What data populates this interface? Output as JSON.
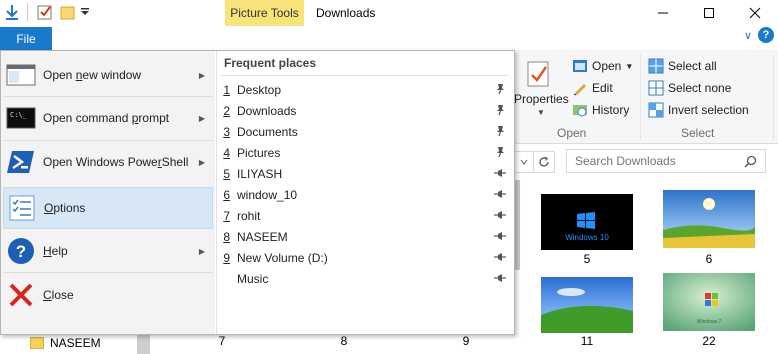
{
  "titlebar": {
    "contextual_tab": "Picture Tools",
    "title": "Downloads"
  },
  "tabs": {
    "file": "File"
  },
  "ribbon": {
    "properties_label": "Properties",
    "open_label": "Open",
    "edit_label": "Edit",
    "history_label": "History",
    "open_group": "Open",
    "select_all": "Select all",
    "select_none": "Select none",
    "invert_selection": "Invert selection",
    "select_group": "Select"
  },
  "search": {
    "placeholder": "Search Downloads"
  },
  "file_menu": {
    "items": [
      {
        "pre": "Open ",
        "key": "n",
        "post": "ew window",
        "icon": "new-window-icon"
      },
      {
        "pre": "Open command ",
        "key": "p",
        "post": "rompt",
        "icon": "command-prompt-icon"
      },
      {
        "pre": "Open Windows Powe",
        "key": "r",
        "post": "Shell",
        "icon": "powershell-icon"
      },
      {
        "pre": "",
        "key": "O",
        "post": "ptions",
        "icon": "options-icon"
      },
      {
        "pre": "",
        "key": "H",
        "post": "elp",
        "icon": "help-icon"
      },
      {
        "pre": "",
        "key": "C",
        "post": "lose",
        "icon": "close-icon"
      }
    ],
    "frequent_places_header": "Frequent places",
    "frequent_places": [
      {
        "num": "1",
        "label": "Desktop",
        "pinned": true
      },
      {
        "num": "2",
        "label": "Downloads",
        "pinned": true
      },
      {
        "num": "3",
        "label": "Documents",
        "pinned": true
      },
      {
        "num": "4",
        "label": "Pictures",
        "pinned": true
      },
      {
        "num": "5",
        "label": "ILIYASH",
        "pinned": false
      },
      {
        "num": "6",
        "label": "window_10",
        "pinned": false
      },
      {
        "num": "7",
        "label": "rohit",
        "pinned": false
      },
      {
        "num": "8",
        "label": "NASEEM",
        "pinned": false
      },
      {
        "num": "9",
        "label": "New Volume (D:)",
        "pinned": false
      },
      {
        "num": "",
        "label": "Music",
        "pinned": false
      }
    ]
  },
  "sidebar": {
    "items": [
      "NASEEM"
    ]
  },
  "files": {
    "captions": [
      "5",
      "6",
      "11",
      "22",
      "7",
      "8",
      "9"
    ],
    "thumb_text": {
      "win10": "Windows 10",
      "win7": "Windows 7"
    }
  },
  "colors": {
    "accent": "#1979ca",
    "contextual_tab": "#f8e27a",
    "menu_left_bg": "#f3f3f3",
    "selected_item": "#d7e7f5"
  }
}
